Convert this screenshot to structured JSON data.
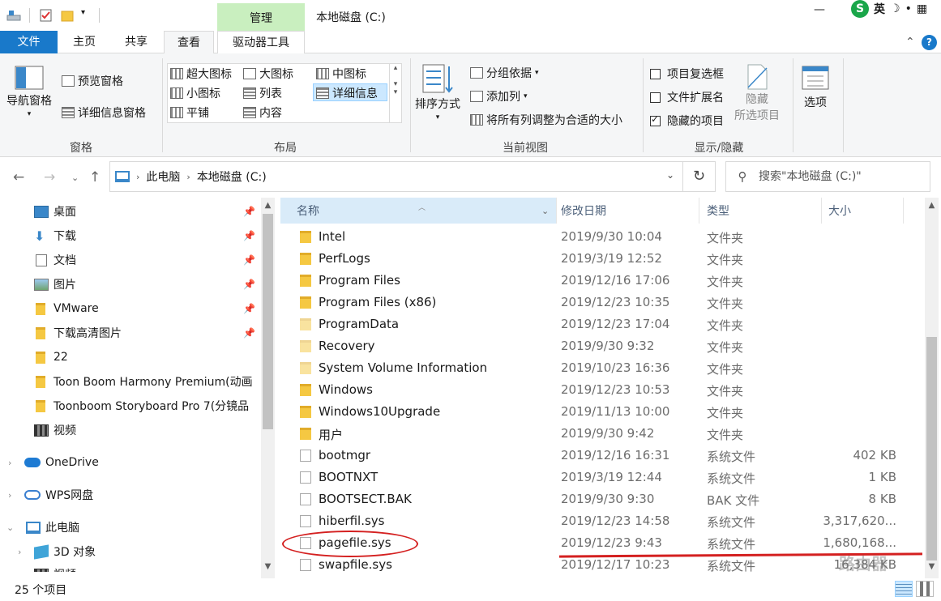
{
  "titlebar": {
    "context_group": "管理",
    "title": "本地磁盘 (C:)",
    "minimize": "—",
    "close": "✕",
    "ime": {
      "lang": "英",
      "moon": "☽",
      "dot": "•",
      "grid": "▦"
    }
  },
  "tabs": [
    {
      "label": "文件"
    },
    {
      "label": "主页"
    },
    {
      "label": "共享"
    },
    {
      "label": "查看"
    },
    {
      "label": "驱动器工具"
    }
  ],
  "ribbon": {
    "pane_group": {
      "nav_pane": "导航窗格",
      "preview_pane": "预览窗格",
      "details_pane": "详细信息窗格",
      "label": "窗格"
    },
    "layout_group": {
      "items": [
        "超大图标",
        "大图标",
        "中图标",
        "小图标",
        "列表",
        "详细信息",
        "平铺",
        "内容"
      ],
      "label": "布局"
    },
    "current_view_group": {
      "sort_by": "排序方式",
      "group_by": "分组依据",
      "add_columns": "添加列",
      "size_all": "将所有列调整为合适的大小",
      "label": "当前视图"
    },
    "show_hide_group": {
      "item_checkboxes": {
        "label": "项目复选框",
        "checked": false
      },
      "file_extensions": {
        "label": "文件扩展名",
        "checked": false
      },
      "hidden_items": {
        "label": "隐藏的项目",
        "checked": true
      },
      "hide_selected_1": "隐藏",
      "hide_selected_2": "所选项目",
      "label": "显示/隐藏"
    },
    "options": "选项"
  },
  "address": {
    "crumbs": [
      "此电脑",
      "本地磁盘 (C:)"
    ],
    "search_placeholder": "搜索\"本地磁盘 (C:)\""
  },
  "nav_pane": {
    "items": [
      {
        "label": "桌面",
        "pinned": true
      },
      {
        "label": "下载",
        "pinned": true
      },
      {
        "label": "文档",
        "pinned": true
      },
      {
        "label": "图片",
        "pinned": true
      },
      {
        "label": "VMware",
        "pinned": true
      },
      {
        "label": "下载高清图片",
        "pinned": true
      },
      {
        "label": "22"
      },
      {
        "label": "Toon Boom Harmony Premium(动画"
      },
      {
        "label": "Toonboom Storyboard Pro 7(分镜品"
      },
      {
        "label": "视频"
      },
      {
        "label": "OneDrive"
      },
      {
        "label": "WPS网盘"
      },
      {
        "label": "此电脑"
      },
      {
        "label": "3D 对象"
      },
      {
        "label": "视频"
      }
    ]
  },
  "columns": [
    "名称",
    "修改日期",
    "类型",
    "大小"
  ],
  "files": [
    {
      "name": "Intel",
      "date": "2019/9/30 10:04",
      "type": "文件夹",
      "size": "",
      "kind": "folder"
    },
    {
      "name": "PerfLogs",
      "date": "2019/3/19 12:52",
      "type": "文件夹",
      "size": "",
      "kind": "folder"
    },
    {
      "name": "Program Files",
      "date": "2019/12/16 17:06",
      "type": "文件夹",
      "size": "",
      "kind": "folder"
    },
    {
      "name": "Program Files (x86)",
      "date": "2019/12/23 10:35",
      "type": "文件夹",
      "size": "",
      "kind": "folder"
    },
    {
      "name": "ProgramData",
      "date": "2019/12/23 17:04",
      "type": "文件夹",
      "size": "",
      "kind": "folder-faded"
    },
    {
      "name": "Recovery",
      "date": "2019/9/30 9:32",
      "type": "文件夹",
      "size": "",
      "kind": "folder-faded"
    },
    {
      "name": "System Volume Information",
      "date": "2019/10/23 16:36",
      "type": "文件夹",
      "size": "",
      "kind": "folder-faded"
    },
    {
      "name": "Windows",
      "date": "2019/12/23 10:53",
      "type": "文件夹",
      "size": "",
      "kind": "folder"
    },
    {
      "name": "Windows10Upgrade",
      "date": "2019/11/13 10:00",
      "type": "文件夹",
      "size": "",
      "kind": "folder"
    },
    {
      "name": "用户",
      "date": "2019/9/30 9:42",
      "type": "文件夹",
      "size": "",
      "kind": "folder"
    },
    {
      "name": "bootmgr",
      "date": "2019/12/16 16:31",
      "type": "系统文件",
      "size": "402 KB",
      "kind": "file"
    },
    {
      "name": "BOOTNXT",
      "date": "2019/3/19 12:44",
      "type": "系统文件",
      "size": "1 KB",
      "kind": "file"
    },
    {
      "name": "BOOTSECT.BAK",
      "date": "2019/9/30 9:30",
      "type": "BAK 文件",
      "size": "8 KB",
      "kind": "file"
    },
    {
      "name": "hiberfil.sys",
      "date": "2019/12/23 14:58",
      "type": "系统文件",
      "size": "3,317,620...",
      "kind": "file"
    },
    {
      "name": "pagefile.sys",
      "date": "2019/12/23 9:43",
      "type": "系统文件",
      "size": "1,680,168...",
      "kind": "file"
    },
    {
      "name": "swapfile.sys",
      "date": "2019/12/17 10:23",
      "type": "系统文件",
      "size": "16,384 KB",
      "kind": "file"
    }
  ],
  "status": {
    "count": "25 个项目"
  },
  "watermark": "路由器"
}
